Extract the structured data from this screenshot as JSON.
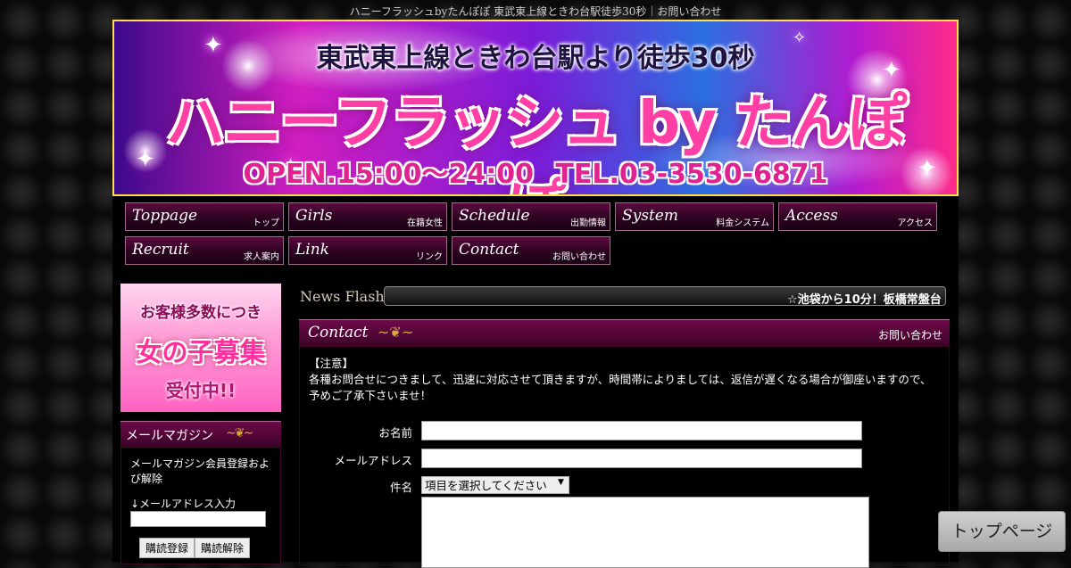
{
  "site_title": "ハニーフラッシュbyたんぽぽ 東武東上線ときわ台駅徒歩30秒｜お問い合わせ",
  "banner": {
    "line1": "東武東上線ときわ台駅より徒歩30秒",
    "line2": "ハニーフラッシュ by たんぽぽ",
    "line3": "OPEN.15:00～24:00 TEL.03-3530-6871"
  },
  "nav": [
    {
      "en": "Toppage",
      "jp": "トップ"
    },
    {
      "en": "Girls",
      "jp": "在籍女性"
    },
    {
      "en": "Schedule",
      "jp": "出勤情報"
    },
    {
      "en": "System",
      "jp": "料金システム"
    },
    {
      "en": "Access",
      "jp": "アクセス"
    },
    {
      "en": "Recruit",
      "jp": "求人案内"
    },
    {
      "en": "Link",
      "jp": "リンク"
    },
    {
      "en": "Contact",
      "jp": "お問い合わせ"
    }
  ],
  "sidebar": {
    "recruit_banner": {
      "line1": "お客様多数につき",
      "line2": "女の子募集",
      "line3": "受付中!!"
    },
    "mailmag": {
      "title": "メールマガジン",
      "desc": "メールマガジン会員登録および解除",
      "input_label": "↓メールアドレス入力",
      "subscribe": "購読登録",
      "unsubscribe": "購読解除"
    }
  },
  "news": {
    "label": "News Flash",
    "text": "☆池袋から10分！板橋常盤台"
  },
  "section": {
    "title_en": "Contact",
    "title_jp": "お問い合わせ"
  },
  "notice": {
    "heading": "【注意】",
    "body": "各種お問合せにつきまして、迅速に対応させて頂きますが、時間帯によりましては、返信が遅くなる場合が御座いますので、予めご了承下さいませ！"
  },
  "form": {
    "name_label": "お名前",
    "email_label": "メールアドレス",
    "subject_label": "件名",
    "subject_selected": "項目を選択してください"
  },
  "top_button": "トップページ",
  "colors": {
    "accent_pink": "#ff3fa3",
    "nav_bg": "#5b0a3e",
    "gold": "#d9a83a"
  }
}
